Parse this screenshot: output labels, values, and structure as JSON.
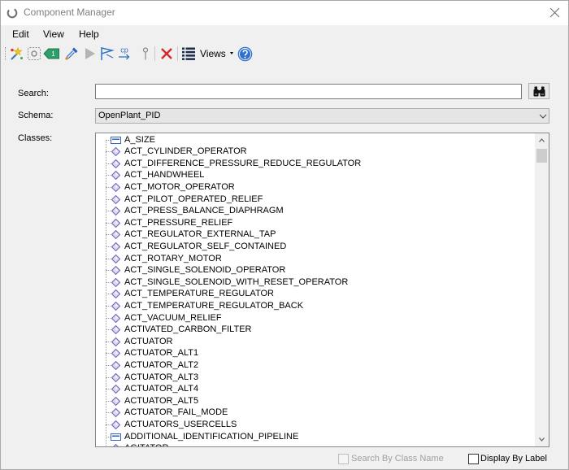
{
  "window": {
    "title": "Component Manager"
  },
  "menu": [
    {
      "label": "Edit"
    },
    {
      "label": "View"
    },
    {
      "label": "Help"
    }
  ],
  "toolbar": {
    "tag_number": "1",
    "copy_icon_text": "cp",
    "views_label": "Views",
    "icons": [
      "new-component-icon",
      "select-region-icon",
      "tag-number-icon",
      "eyedropper-icon",
      "play-icon",
      "flag-select-icon",
      "copy-paste-icon",
      "pin-icon",
      "delete-icon",
      "views-list-icon",
      "dropdown-arrow-icon",
      "help-icon"
    ]
  },
  "search": {
    "label": "Search:",
    "value": "",
    "button_icon": "binoculars-icon"
  },
  "schema": {
    "label": "Schema:",
    "value": "OpenPlant_PID"
  },
  "classes": {
    "label": "Classes:",
    "scroll_position": 0,
    "items": [
      {
        "label": "A_SIZE",
        "icon": "box"
      },
      {
        "label": "ACT_CYLINDER_OPERATOR",
        "icon": "diamond"
      },
      {
        "label": "ACT_DIFFERENCE_PRESSURE_REDUCE_REGULATOR",
        "icon": "diamond"
      },
      {
        "label": "ACT_HANDWHEEL",
        "icon": "diamond"
      },
      {
        "label": "ACT_MOTOR_OPERATOR",
        "icon": "diamond"
      },
      {
        "label": "ACT_PILOT_OPERATED_RELIEF",
        "icon": "diamond"
      },
      {
        "label": "ACT_PRESS_BALANCE_DIAPHRAGM",
        "icon": "diamond"
      },
      {
        "label": "ACT_PRESSURE_RELIEF",
        "icon": "diamond"
      },
      {
        "label": "ACT_REGULATOR_EXTERNAL_TAP",
        "icon": "diamond"
      },
      {
        "label": "ACT_REGULATOR_SELF_CONTAINED",
        "icon": "diamond"
      },
      {
        "label": "ACT_ROTARY_MOTOR",
        "icon": "diamond"
      },
      {
        "label": "ACT_SINGLE_SOLENOID_OPERATOR",
        "icon": "diamond"
      },
      {
        "label": "ACT_SINGLE_SOLENOID_WITH_RESET_OPERATOR",
        "icon": "diamond"
      },
      {
        "label": "ACT_TEMPERATURE_REGULATOR",
        "icon": "diamond"
      },
      {
        "label": "ACT_TEMPERATURE_REGULATOR_BACK",
        "icon": "diamond"
      },
      {
        "label": "ACT_VACUUM_RELIEF",
        "icon": "diamond"
      },
      {
        "label": "ACTIVATED_CARBON_FILTER",
        "icon": "diamond"
      },
      {
        "label": "ACTUATOR",
        "icon": "diamond"
      },
      {
        "label": "ACTUATOR_ALT1",
        "icon": "diamond"
      },
      {
        "label": "ACTUATOR_ALT2",
        "icon": "diamond"
      },
      {
        "label": "ACTUATOR_ALT3",
        "icon": "diamond"
      },
      {
        "label": "ACTUATOR_ALT4",
        "icon": "diamond"
      },
      {
        "label": "ACTUATOR_ALT5",
        "icon": "diamond"
      },
      {
        "label": "ACTUATOR_FAIL_MODE",
        "icon": "diamond"
      },
      {
        "label": "ACTUATORS_USERCELLS",
        "icon": "diamond"
      },
      {
        "label": "ADDITIONAL_IDENTIFICATION_PIPELINE",
        "icon": "box"
      },
      {
        "label": "AGITATOR",
        "icon": "diamond"
      }
    ]
  },
  "options": {
    "search_by_class_name": {
      "label": "Search By Class Name",
      "checked": false,
      "enabled": false
    },
    "display_by_label": {
      "label": "Display By Label",
      "checked": false,
      "enabled": true
    }
  },
  "colors": {
    "title_text": "#7f7f7f",
    "class_icon_stroke": "#6c62b0",
    "class_icon_fill": "#dcd8f5",
    "box_icon": "#3566c4",
    "delete": "#d9262c",
    "help": "#2f6fd0",
    "tag": "#2e9e6a",
    "disabled_text": "#a0a0a0"
  }
}
